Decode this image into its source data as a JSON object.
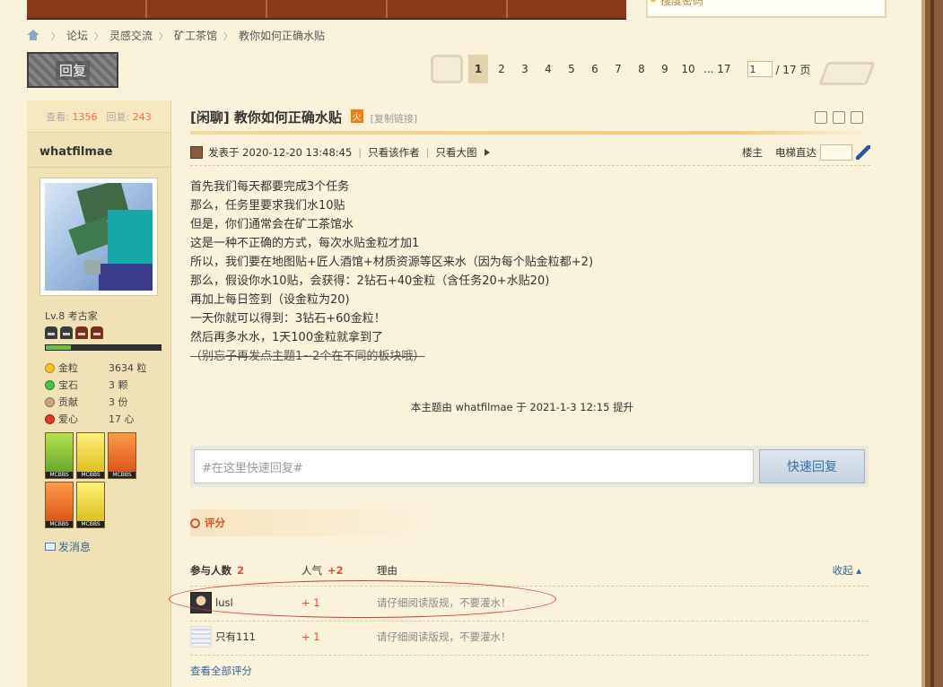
{
  "search": {
    "hint": "搜度密码"
  },
  "breadcrumb": {
    "items": [
      "论坛",
      "灵感交流",
      "矿工茶馆",
      "教你如何正确水贴"
    ]
  },
  "actions": {
    "reply_label": "回复"
  },
  "pager": {
    "pages": [
      "1",
      "2",
      "3",
      "4",
      "5",
      "6",
      "7",
      "8",
      "9",
      "10",
      "... 17"
    ],
    "current": "1",
    "input_value": "1",
    "total_label": "/ 17 页"
  },
  "sidebar": {
    "views_label": "查看:",
    "views": "1356",
    "replies_label": "回复:",
    "replies": "243",
    "username": "whatfilmae",
    "level": "Lv.8 考古家",
    "xp_fraction": 0.22,
    "credits": [
      {
        "icon": "gold",
        "label": "金粒",
        "value": "3634 粒"
      },
      {
        "icon": "gem",
        "label": "宝石",
        "value": "3 颗"
      },
      {
        "icon": "contrib",
        "label": "贡献",
        "value": "3 份"
      },
      {
        "icon": "love",
        "label": "爱心",
        "value": "17 心"
      }
    ],
    "medal_label": "MCBBS",
    "pm_label": "发消息"
  },
  "thread": {
    "title": "[闲聊] 教你如何正确水贴",
    "hot_badge": "火",
    "copy_link": "[复制链接]",
    "posted": "发表于 2020-12-20 13:48:45",
    "only_author": "只看该作者",
    "big_image": "只看大图",
    "floor": "楼主",
    "jump_label": "电梯直达",
    "body": [
      "首先我们每天都要完成3个任务",
      "那么，任务里要求我们水10贴",
      "但是，你们通常会在矿工茶馆水",
      "这是一种不正确的方式，每次水贴金粒才加1",
      "所以，我们要在地图贴+匠人酒馆+材质资源等区来水（因为每个贴金粒都+2)",
      "那么，假设你水10贴，会获得：2钻石+40金粒（含任务20+水贴20)",
      "再加上每日签到（设金粒为20)",
      "一天你就可以得到：3钻石+60金粒！",
      "然后再多水水，1天100金粒就拿到了"
    ],
    "strike_line": "（别忘子再发点主题1~2个在不同的板块哦）",
    "bump_note": "本主题由 whatfilmae 于 2021-1-3 12:15 提升"
  },
  "quick_reply": {
    "placeholder": "#在这里快速回复#",
    "button": "快速回复"
  },
  "rating": {
    "header": "评分",
    "participants_label": "参与人数",
    "participants": "2",
    "popularity_label": "人气",
    "popularity": "+2",
    "reason_label": "理由",
    "collapse_label": "收起",
    "rows": [
      {
        "name": "lusl",
        "score": "+ 1",
        "reason": "请仔细阅读版规，不要灌水！"
      },
      {
        "name": "只有111",
        "score": "+ 1",
        "reason": "请仔细阅读版规，不要灌水！"
      }
    ],
    "view_all": "查看全部评分"
  },
  "colors": {
    "accent": "#e0502e",
    "link": "#336699",
    "sidebar_bg": "#f0e2b6",
    "page_bg": "#fbf2db"
  }
}
